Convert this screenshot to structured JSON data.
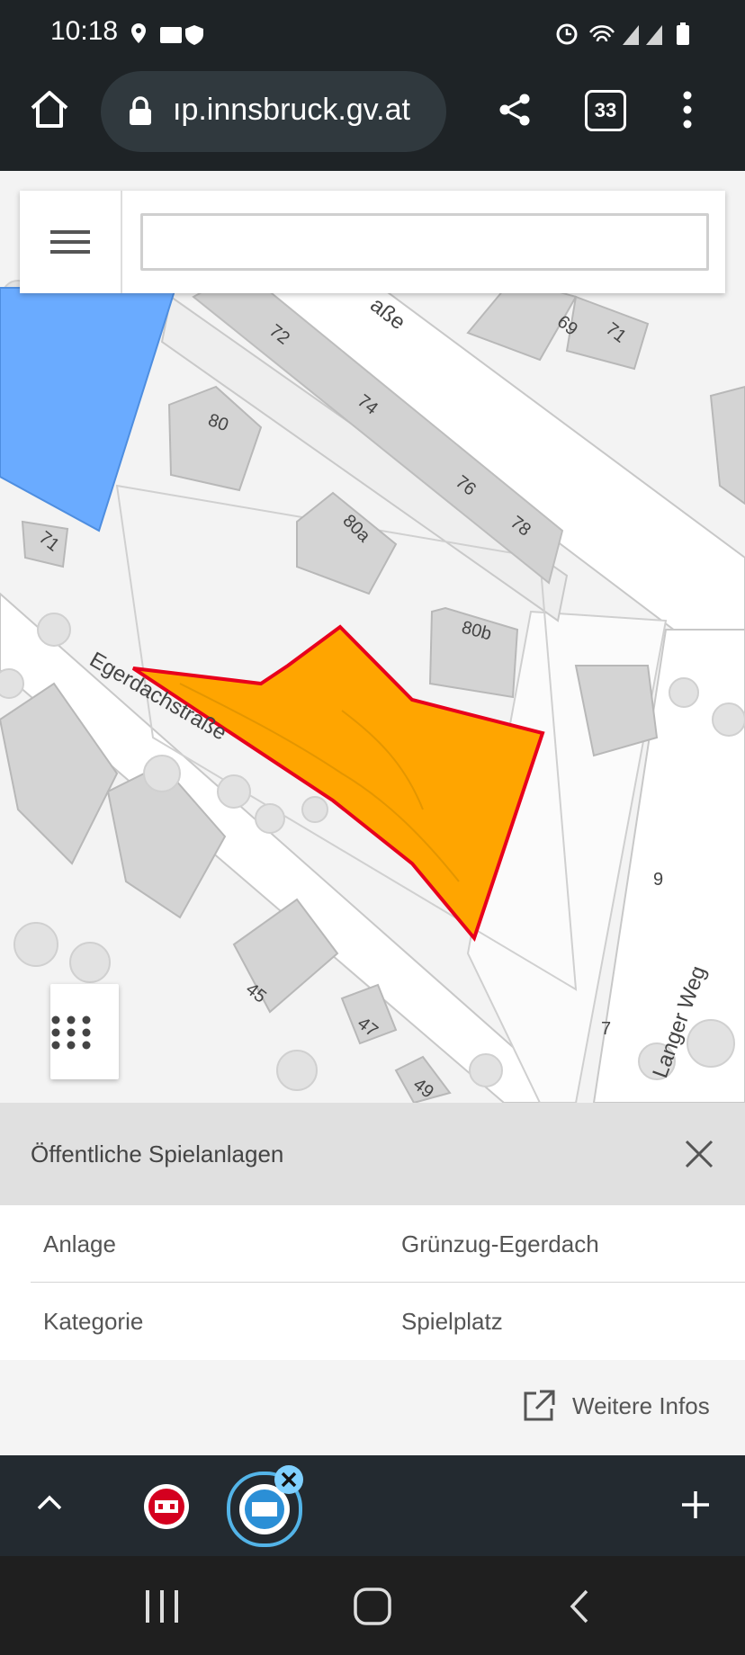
{
  "status_bar": {
    "time": "10:18"
  },
  "browser": {
    "url": "ıp.innsbruck.gv.at",
    "tab_count": "33"
  },
  "map": {
    "labels": {
      "n72": "72",
      "n74": "74",
      "n76": "76",
      "n78": "78",
      "n80": "80",
      "n80a": "80a",
      "n80b": "80b",
      "n69": "69",
      "n71a": "71",
      "n71b": "71",
      "n45": "45",
      "n47": "47",
      "n49": "49",
      "n9": "9",
      "n7": "7",
      "street_egerdach": "Egerdachstraße",
      "street_top": "aße",
      "street_langer": "Langer Weg"
    },
    "highlight_color": "#ffa500",
    "highlight_border": "#e8001c",
    "blue_area_color": "#6aabff"
  },
  "panel": {
    "title": "Öffentliche Spielanlagen",
    "rows": [
      {
        "key": "Anlage",
        "value": "Grünzug-Egerdach"
      },
      {
        "key": "Kategorie",
        "value": "Spielplatz"
      }
    ],
    "more_label": "Weitere Infos"
  }
}
